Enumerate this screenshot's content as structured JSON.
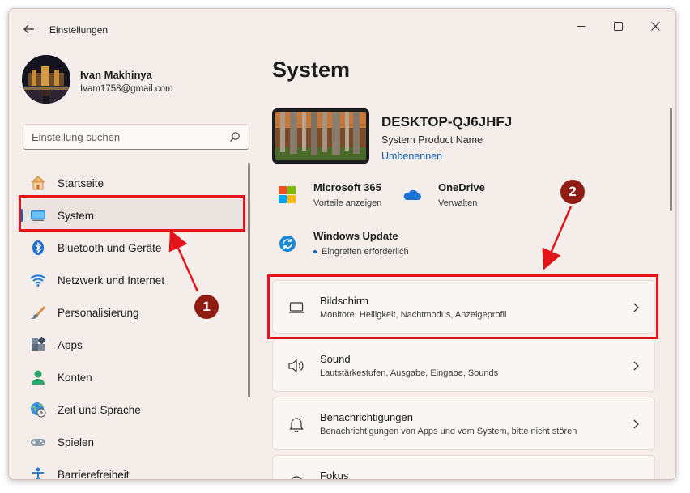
{
  "app": {
    "title": "Einstellungen"
  },
  "profile": {
    "name": "Ivan Makhinya",
    "email": "Ivam1758@gmail.com"
  },
  "search": {
    "placeholder": "Einstellung suchen"
  },
  "sidebar": {
    "items": [
      {
        "label": "Startseite",
        "icon": "home-icon"
      },
      {
        "label": "System",
        "icon": "monitor-icon"
      },
      {
        "label": "Bluetooth und Geräte",
        "icon": "bluetooth-icon"
      },
      {
        "label": "Netzwerk und Internet",
        "icon": "wifi-icon"
      },
      {
        "label": "Personalisierung",
        "icon": "brush-icon"
      },
      {
        "label": "Apps",
        "icon": "apps-icon"
      },
      {
        "label": "Konten",
        "icon": "person-icon"
      },
      {
        "label": "Zeit und Sprache",
        "icon": "globe-clock-icon"
      },
      {
        "label": "Spielen",
        "icon": "gamepad-icon"
      },
      {
        "label": "Barrierefreiheit",
        "icon": "accessibility-icon"
      }
    ],
    "selected": "System"
  },
  "main": {
    "title": "System",
    "device": {
      "name": "DESKTOP-QJ6JHFJ",
      "model": "System Product Name",
      "rename": "Umbenennen"
    },
    "tiles": [
      {
        "title": "Microsoft 365",
        "subtitle": "Vorteile anzeigen",
        "icon": "microsoft-365-icon"
      },
      {
        "title": "OneDrive",
        "subtitle": "Verwalten",
        "icon": "onedrive-icon"
      },
      {
        "title": "Windows Update",
        "subtitle": "Eingreifen erforderlich",
        "icon": "windows-update-icon"
      }
    ],
    "cards": [
      {
        "title": "Bildschirm",
        "subtitle": "Monitore, Helligkeit, Nachtmodus, Anzeigeprofil",
        "icon": "display-icon"
      },
      {
        "title": "Sound",
        "subtitle": "Lautstärkestufen, Ausgabe, Eingabe, Sounds",
        "icon": "speaker-icon"
      },
      {
        "title": "Benachrichtigungen",
        "subtitle": "Benachrichtigungen von Apps und vom System, bitte nicht stören",
        "icon": "bell-icon"
      },
      {
        "title": "Fokus",
        "subtitle": "",
        "icon": "focus-icon"
      }
    ]
  },
  "annotations": {
    "badge_1": "1",
    "badge_2": "2",
    "highlight_color": "#e3151b",
    "badge_color": "#8f1d13"
  },
  "colors": {
    "accent": "#0067c0",
    "window_bg": "#f5ede9",
    "card_bg": "#faf6f3"
  }
}
